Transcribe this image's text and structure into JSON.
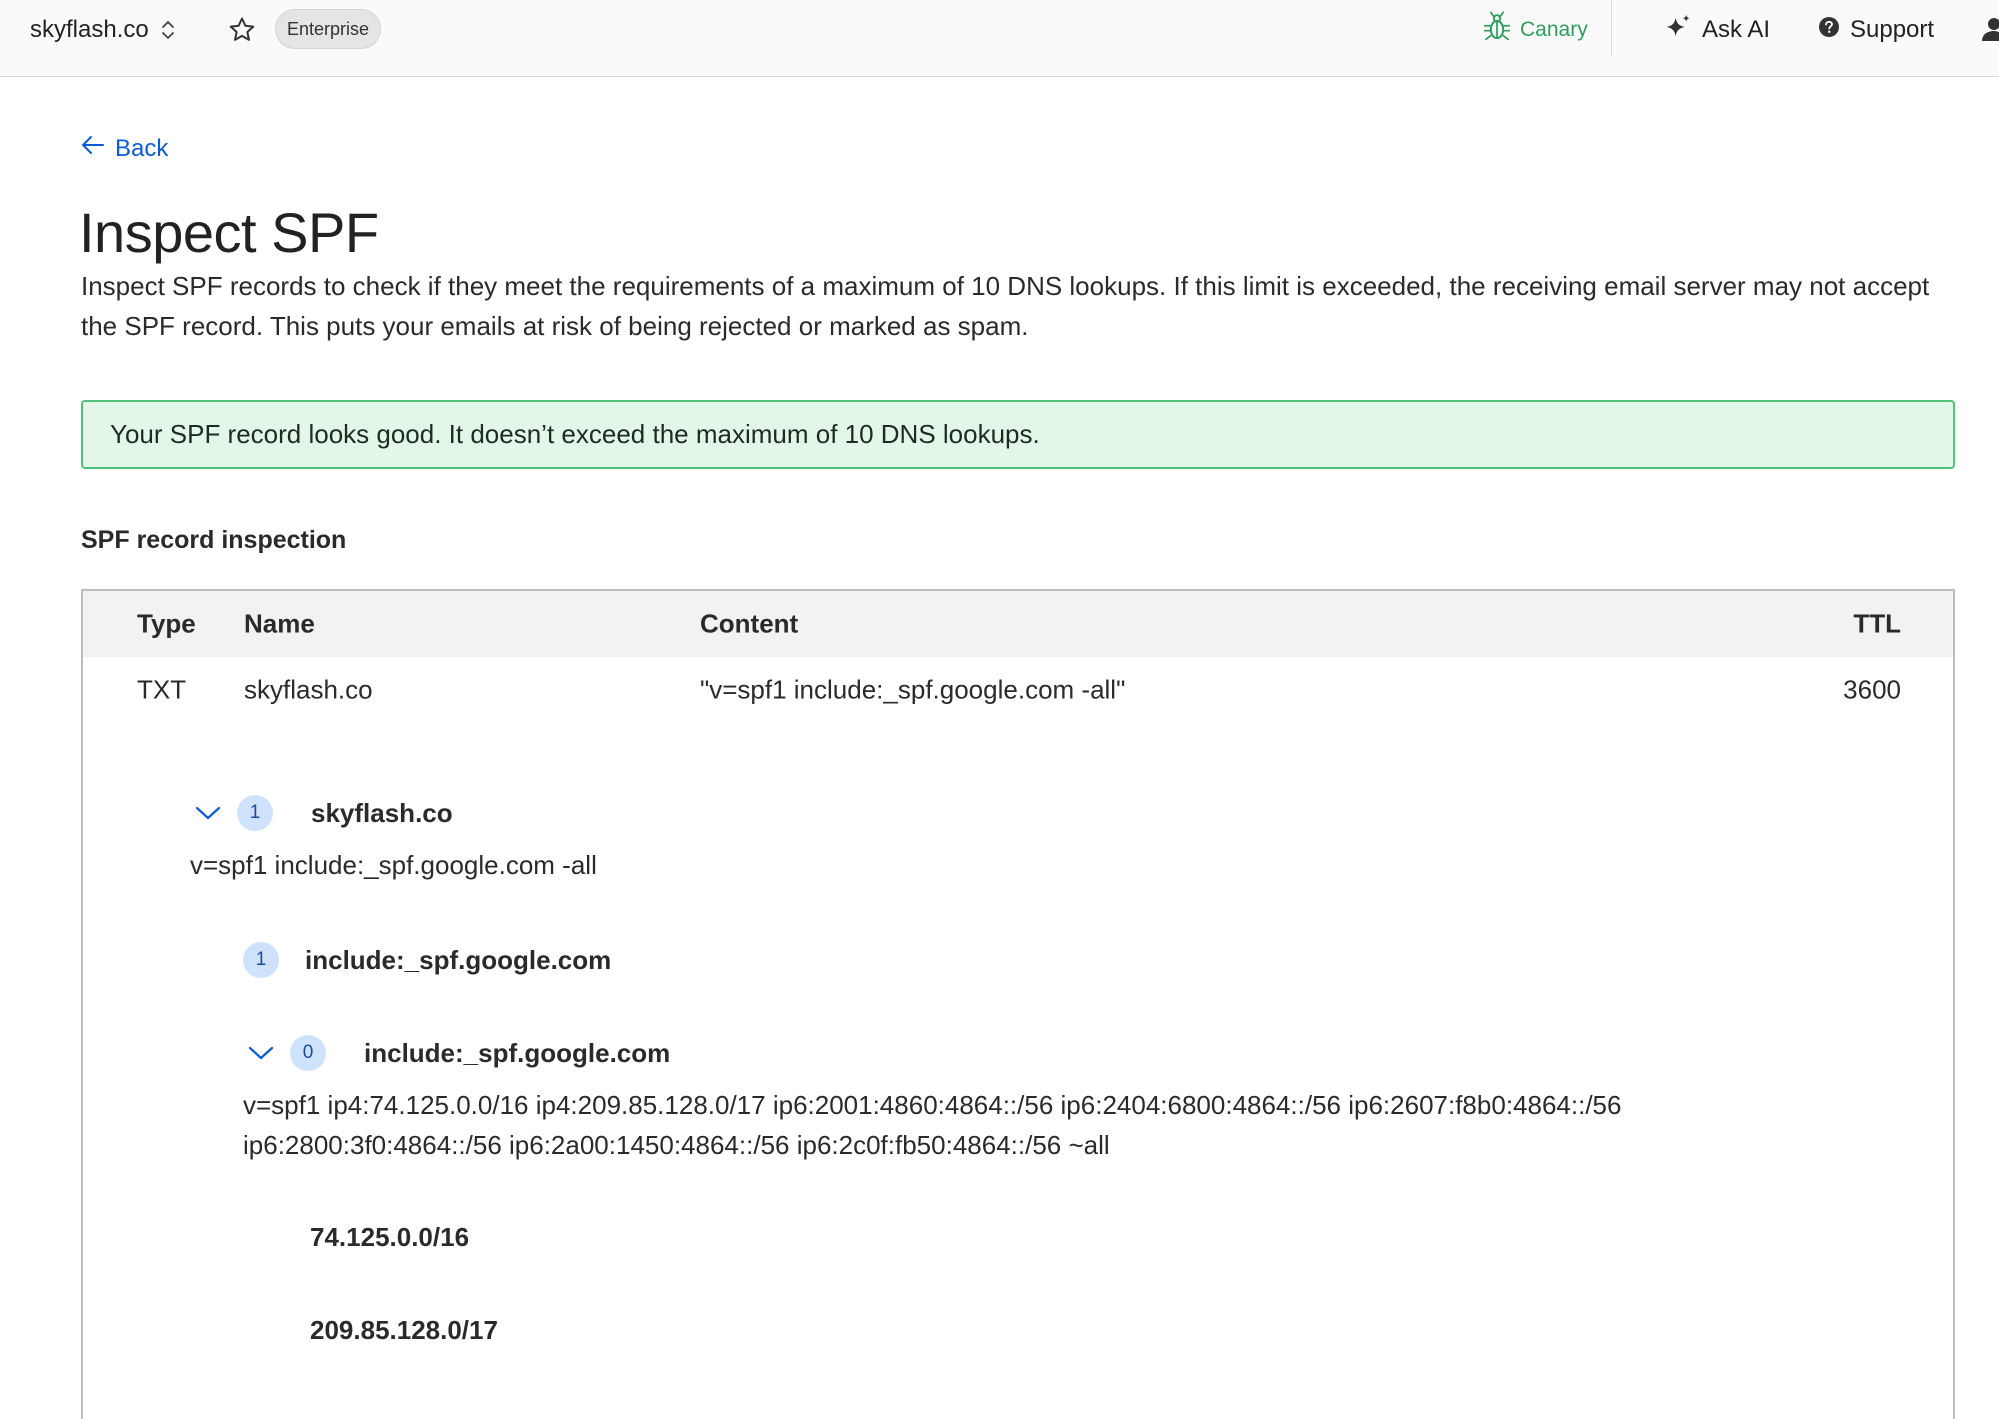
{
  "topbar": {
    "account_name": "skyflash.co",
    "plan_badge": "Enterprise",
    "canary_label": "Canary",
    "ask_ai_label": "Ask AI",
    "support_label": "Support"
  },
  "page": {
    "back_label": "Back",
    "title": "Inspect SPF",
    "description": "Inspect SPF records to check if they meet the requirements of a maximum of 10 DNS lookups. If this limit is exceeded, the receiving email server may not accept the SPF record. This puts your emails at risk of being rejected or marked as spam.",
    "success_message": "Your SPF record looks good. It doesn’t exceed the maximum of 10 DNS lookups.",
    "section_heading": "SPF record inspection"
  },
  "table": {
    "columns": [
      "Type",
      "Name",
      "Content",
      "TTL"
    ],
    "rows": [
      {
        "type": "TXT",
        "name": "skyflash.co",
        "content": "\"v=spf1 include:_spf.google.com -all\"",
        "ttl": "3600"
      }
    ]
  },
  "spf_tree": {
    "root": {
      "lookup_count": "1",
      "label": "skyflash.co",
      "record": "v=spf1 include:_spf.google.com -all"
    },
    "include_collapsed": {
      "lookup_count": "1",
      "label": "include:_spf.google.com"
    },
    "include_expanded": {
      "lookup_count": "0",
      "label": "include:_spf.google.com",
      "record_line1": "v=spf1 ip4:74.125.0.0/16 ip4:209.85.128.0/17 ip6:2001:4860:4864::/56 ip6:2404:6800:4864::/56 ip6:2607:f8b0:4864::/56",
      "record_line2": "ip6:2800:3f0:4864::/56 ip6:2a00:1450:4864::/56 ip6:2c0f:fb50:4864::/56 ~all",
      "ip_entries": [
        "74.125.0.0/16",
        "209.85.128.0/17"
      ]
    }
  },
  "colors": {
    "accent_link": "#0a5bd4",
    "success_bg": "#e3f7e8",
    "success_border": "#4fc17a",
    "canary_green": "#2f9e5b",
    "badge_blue_bg": "#cfe2fb"
  },
  "icons": {
    "account_switcher": "chevron-up-down-icon",
    "favorite": "star-icon",
    "canary": "bug-icon",
    "ask_ai": "sparkle-icon",
    "support": "help-circle-icon",
    "user": "user-icon",
    "back": "arrow-left-icon",
    "expand": "chevron-down-icon"
  }
}
